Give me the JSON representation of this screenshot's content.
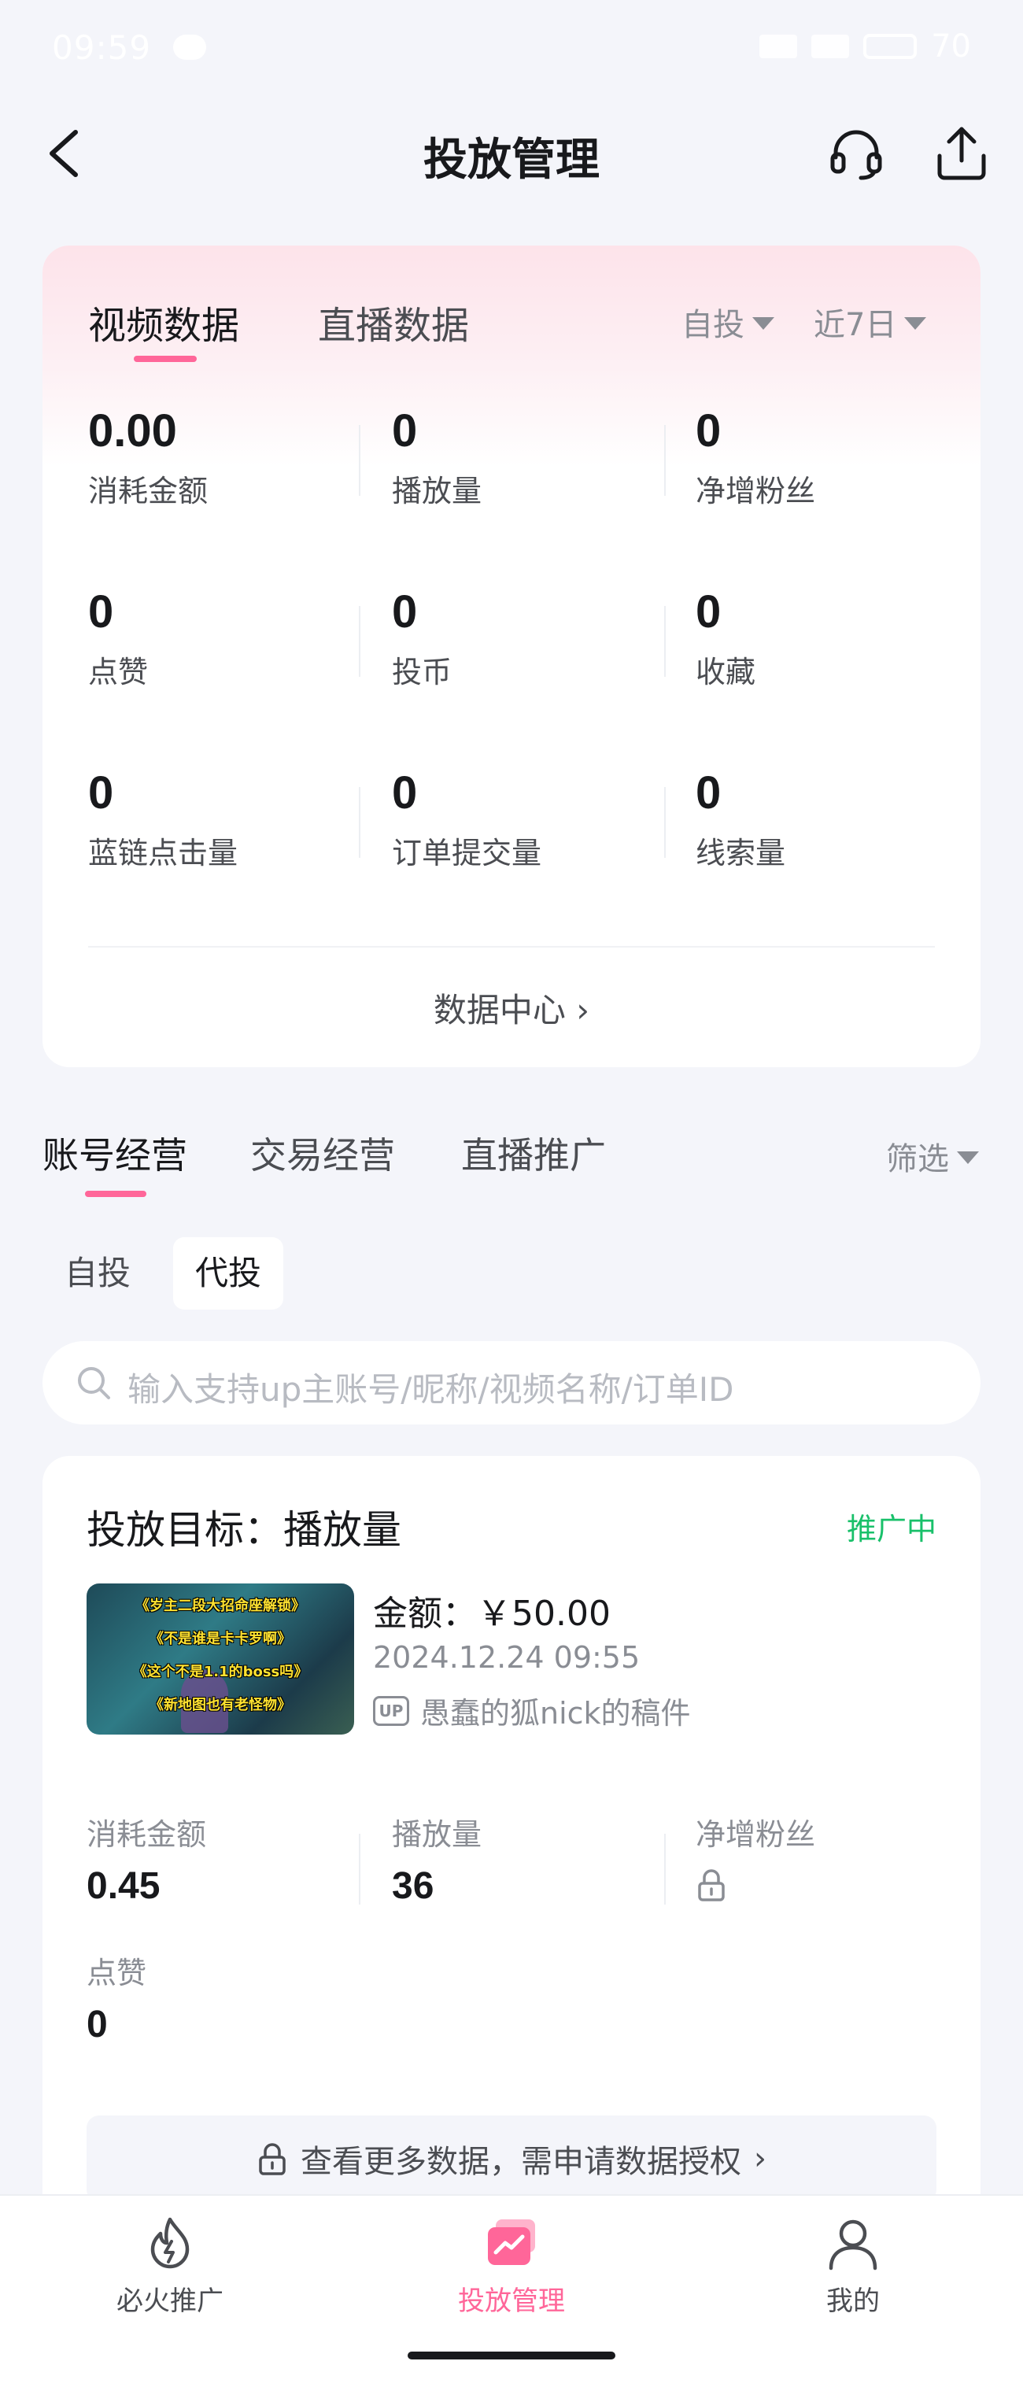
{
  "status_bar": {
    "time": "09:59",
    "battery": "70"
  },
  "header": {
    "title": "投放管理"
  },
  "data_card": {
    "tabs": [
      {
        "label": "视频数据"
      },
      {
        "label": "直播数据"
      }
    ],
    "dropdown_mode": "自投",
    "dropdown_period": "近7日",
    "metrics": [
      {
        "value": "0.00",
        "label": "消耗金额"
      },
      {
        "value": "0",
        "label": "播放量"
      },
      {
        "value": "0",
        "label": "净增粉丝"
      },
      {
        "value": "0",
        "label": "点赞"
      },
      {
        "value": "0",
        "label": "投币"
      },
      {
        "value": "0",
        "label": "收藏"
      },
      {
        "value": "0",
        "label": "蓝链点击量"
      },
      {
        "value": "0",
        "label": "订单提交量"
      },
      {
        "value": "0",
        "label": "线索量"
      }
    ],
    "data_center_link": "数据中心 ›"
  },
  "section_tabs": [
    {
      "label": "账号经营"
    },
    {
      "label": "交易经营"
    },
    {
      "label": "直播推广"
    }
  ],
  "filter_label": "筛选",
  "chips": [
    {
      "label": "自投"
    },
    {
      "label": "代投"
    }
  ],
  "search": {
    "placeholder": "输入支持up主账号/昵称/视频名称/订单ID"
  },
  "order": {
    "goal": "投放目标：播放量",
    "status": "推广中",
    "thumbnail_lines": [
      "《岁主二段大招命座解锁》",
      "《不是谁是卡卡罗啊》",
      "《这个不是1.1的boss吗》",
      "《新地图也有老怪物》"
    ],
    "amount": "金额：￥50.00",
    "date": "2024.12.24 09:55",
    "up_badge": "UP",
    "up_text": "愚蠢的狐nick的稿件",
    "metrics": [
      {
        "label": "消耗金额",
        "value": "0.45"
      },
      {
        "label": "播放量",
        "value": "36"
      },
      {
        "label": "净增粉丝",
        "value": ""
      },
      {
        "label": "点赞",
        "value": "0"
      }
    ],
    "auth_text": "查看更多数据，需申请数据授权",
    "auth_chevron": "›"
  },
  "bottom_nav": [
    {
      "label": "必火推广"
    },
    {
      "label": "投放管理"
    },
    {
      "label": "我的"
    }
  ],
  "colors": {
    "accent": "#ff6699",
    "success": "#19c06a",
    "background": "#f4f5fa"
  }
}
